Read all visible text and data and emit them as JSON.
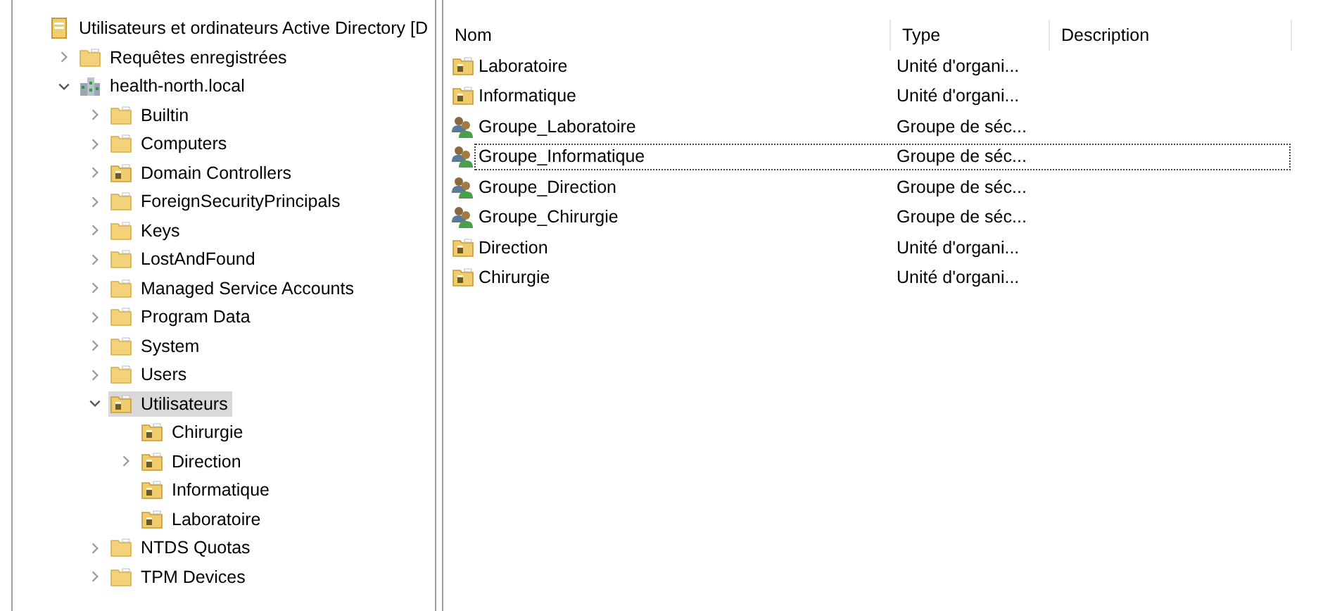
{
  "tree": {
    "label": "Utilisateurs et ordinateurs Active Directory [D",
    "kind": "root",
    "selected": false,
    "children": [
      {
        "label": "Requêtes enregistrées",
        "kind": "folder",
        "has_children": true,
        "expanded": false,
        "selected": false
      },
      {
        "label": "health-north.local",
        "kind": "domain",
        "has_children": true,
        "expanded": true,
        "selected": false,
        "children": [
          {
            "label": "Builtin",
            "kind": "folder",
            "has_children": true,
            "expanded": false,
            "selected": false
          },
          {
            "label": "Computers",
            "kind": "folder",
            "has_children": true,
            "expanded": false,
            "selected": false
          },
          {
            "label": "Domain Controllers",
            "kind": "ou",
            "has_children": true,
            "expanded": false,
            "selected": false
          },
          {
            "label": "ForeignSecurityPrincipals",
            "kind": "folder",
            "has_children": true,
            "expanded": false,
            "selected": false
          },
          {
            "label": "Keys",
            "kind": "folder",
            "has_children": true,
            "expanded": false,
            "selected": false
          },
          {
            "label": "LostAndFound",
            "kind": "folder",
            "has_children": true,
            "expanded": false,
            "selected": false
          },
          {
            "label": "Managed Service Accounts",
            "kind": "folder",
            "has_children": true,
            "expanded": false,
            "selected": false
          },
          {
            "label": "Program Data",
            "kind": "folder",
            "has_children": true,
            "expanded": false,
            "selected": false
          },
          {
            "label": "System",
            "kind": "folder",
            "has_children": true,
            "expanded": false,
            "selected": false
          },
          {
            "label": "Users",
            "kind": "folder",
            "has_children": true,
            "expanded": false,
            "selected": false
          },
          {
            "label": "Utilisateurs",
            "kind": "ou",
            "has_children": true,
            "expanded": true,
            "selected": true,
            "children": [
              {
                "label": "Chirurgie",
                "kind": "ou",
                "has_children": false,
                "selected": false
              },
              {
                "label": "Direction",
                "kind": "ou",
                "has_children": true,
                "expanded": false,
                "selected": false
              },
              {
                "label": "Informatique",
                "kind": "ou",
                "has_children": false,
                "selected": false
              },
              {
                "label": "Laboratoire",
                "kind": "ou",
                "has_children": false,
                "selected": false
              }
            ]
          },
          {
            "label": "NTDS Quotas",
            "kind": "folder",
            "has_children": true,
            "expanded": false,
            "selected": false
          },
          {
            "label": "TPM Devices",
            "kind": "folder",
            "has_children": true,
            "expanded": false,
            "selected": false
          }
        ]
      }
    ]
  },
  "list": {
    "columns": [
      "Nom",
      "Type",
      "Description"
    ],
    "rows": [
      {
        "name": "Laboratoire",
        "kind": "ou",
        "type": "Unité d'organi...",
        "focused": false
      },
      {
        "name": "Informatique",
        "kind": "ou",
        "type": "Unité d'organi...",
        "focused": false
      },
      {
        "name": "Groupe_Laboratoire",
        "kind": "group",
        "type": "Groupe de séc...",
        "focused": false
      },
      {
        "name": "Groupe_Informatique",
        "kind": "group",
        "type": "Groupe de séc...",
        "focused": true
      },
      {
        "name": "Groupe_Direction",
        "kind": "group",
        "type": "Groupe de séc...",
        "focused": false
      },
      {
        "name": "Groupe_Chirurgie",
        "kind": "group",
        "type": "Groupe de séc...",
        "focused": false
      },
      {
        "name": "Direction",
        "kind": "ou",
        "type": "Unité d'organi...",
        "focused": false
      },
      {
        "name": "Chirurgie",
        "kind": "ou",
        "type": "Unité d'organi...",
        "focused": false
      }
    ]
  }
}
